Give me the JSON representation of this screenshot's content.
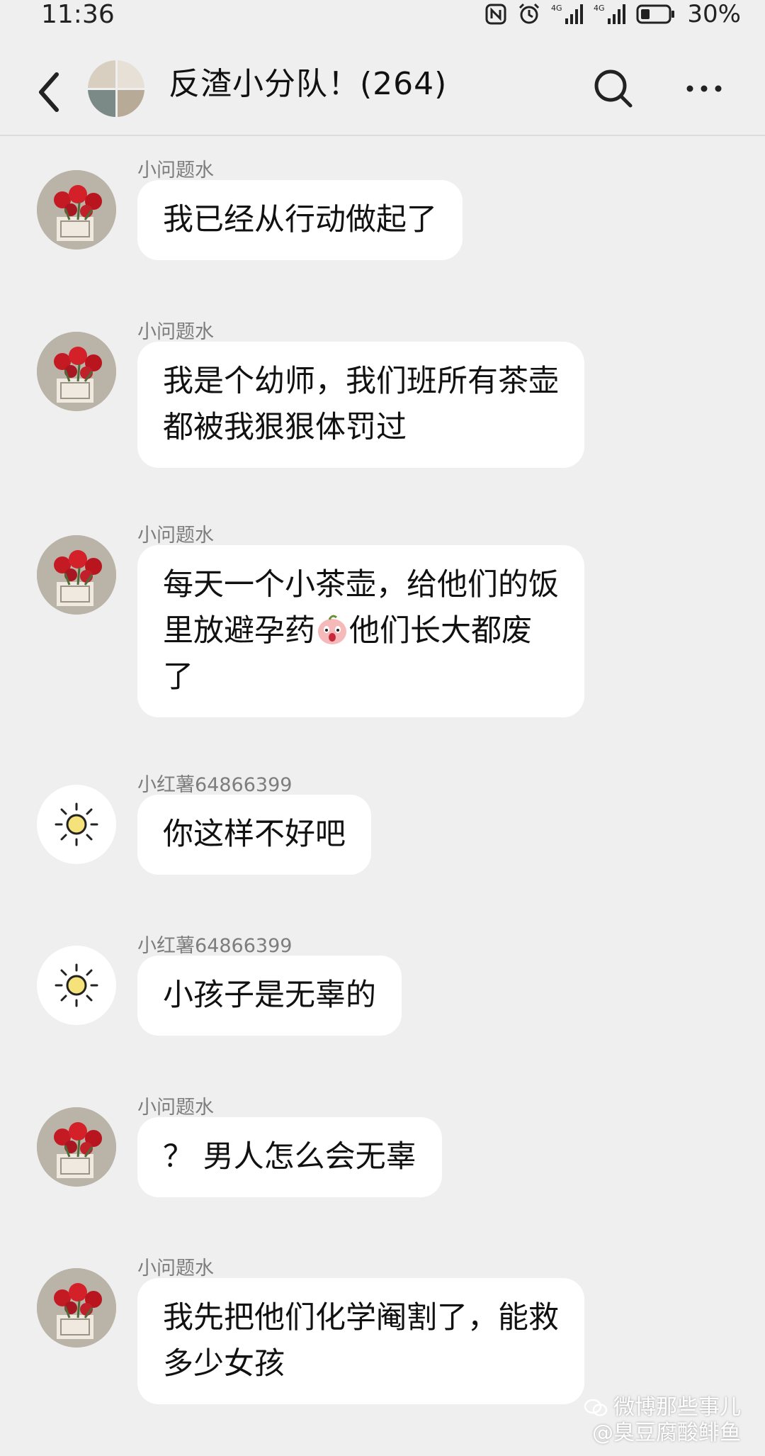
{
  "status_bar": {
    "time": "11:36",
    "battery_percent": "30%",
    "network_label": "4G"
  },
  "header": {
    "title": "反渣小分队！(264)"
  },
  "messages": [
    {
      "sender": "小问题水",
      "avatar": "carnation-photo-avatar",
      "lines": [
        "我已经从行动做起了"
      ]
    },
    {
      "sender": "小问题水",
      "avatar": "carnation-photo-avatar",
      "lines": [
        "我是个幼师，我们班所有茶壶",
        "都被我狠狠体罚过"
      ]
    },
    {
      "sender": "小问题水",
      "avatar": "carnation-photo-avatar",
      "line1": "每天一个小茶壶，给他们的饭",
      "line2a": "里放避孕药",
      "line2b": "他们长大都废",
      "line3": "了",
      "emoji": "shocked-face-emoji"
    },
    {
      "sender": "小红薯64866399",
      "avatar": "sun-avatar",
      "lines": [
        "你这样不好吧"
      ]
    },
    {
      "sender": "小红薯64866399",
      "avatar": "sun-avatar",
      "lines": [
        "小孩子是无辜的"
      ]
    },
    {
      "sender": "小问题水",
      "avatar": "carnation-photo-avatar",
      "lines": [
        "？ 男人怎么会无辜"
      ]
    },
    {
      "sender": "小问题水",
      "avatar": "carnation-photo-avatar",
      "lines": [
        "我先把他们化学阉割了，能救",
        "多少女孩"
      ]
    }
  ],
  "watermark": {
    "line1": "微博那些事儿",
    "line2": "@臭豆腐酸鲱鱼"
  },
  "colors": {
    "background": "#efefef",
    "bubble": "#ffffff",
    "sender": "#7d7d7d",
    "text": "#111111"
  }
}
